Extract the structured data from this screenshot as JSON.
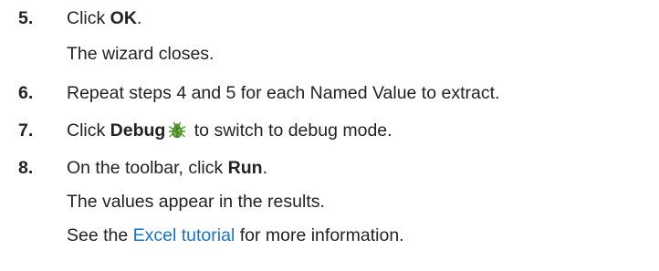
{
  "steps": [
    {
      "number": "5.",
      "line1": {
        "pre": "Click ",
        "bold": "OK",
        "post": "."
      },
      "line2": "The wizard closes."
    },
    {
      "number": "6.",
      "line1": "Repeat steps 4 and 5 for each Named Value to extract."
    },
    {
      "number": "7.",
      "line1": {
        "pre": "Click ",
        "bold": "Debug",
        "post": " to switch to debug mode."
      },
      "icon": "debug-bug-icon"
    },
    {
      "number": "8.",
      "line1": {
        "pre": "On the toolbar, click ",
        "bold": "Run",
        "post": "."
      },
      "line2": "The values appear in the results.",
      "line3": {
        "pre": "See the ",
        "link": "Excel tutorial",
        "post": " for more information."
      }
    }
  ],
  "colors": {
    "text": "#222222",
    "link": "#1a73c8",
    "icon_green": "#4f9a2c"
  }
}
